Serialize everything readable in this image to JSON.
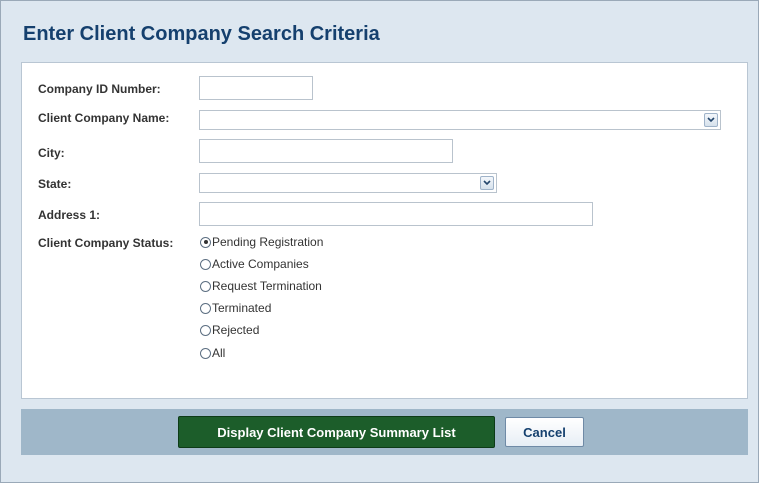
{
  "dialog": {
    "title": "Enter Client Company Search Criteria"
  },
  "form": {
    "company_id": {
      "label": "Company ID Number:",
      "value": ""
    },
    "client_company_name": {
      "label": "Client Company Name:",
      "value": ""
    },
    "city": {
      "label": "City:",
      "value": ""
    },
    "state": {
      "label": "State:",
      "value": ""
    },
    "address1": {
      "label": "Address 1:",
      "value": ""
    },
    "status": {
      "label": "Client Company Status:",
      "selected": "Pending Registration",
      "options": [
        "Pending Registration",
        "Active Companies",
        "Request Termination",
        "Terminated",
        "Rejected",
        "All"
      ]
    }
  },
  "buttons": {
    "display_label": "Display Client Company Summary List",
    "cancel_label": "Cancel",
    "display_color": "#1c5d2a"
  },
  "icons": {
    "dropdown": "chevron-down-icon",
    "radio": "radio-button"
  }
}
